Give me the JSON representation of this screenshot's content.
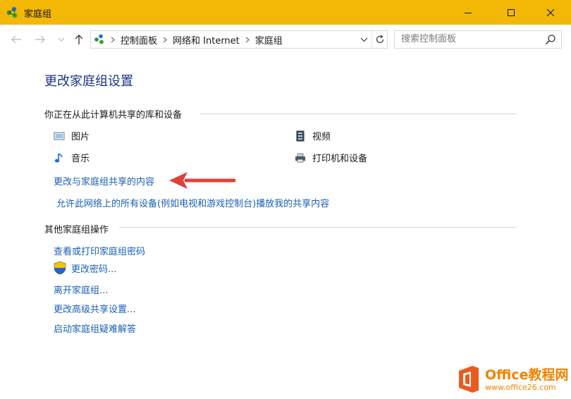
{
  "window": {
    "title": "家庭组",
    "accent_color": "#f3b806"
  },
  "address_bar": {
    "breadcrumbs": [
      "控制面板",
      "网络和 Internet",
      "家庭组"
    ],
    "search_placeholder": "搜索控制面板"
  },
  "main": {
    "title": "更改家庭组设置",
    "sharing_section": {
      "heading": "你正在从此计算机共享的库和设备",
      "items": [
        {
          "label": "图片",
          "icon": "pictures-icon"
        },
        {
          "label": "视频",
          "icon": "videos-icon"
        },
        {
          "label": "音乐",
          "icon": "music-icon"
        },
        {
          "label": "打印机和设备",
          "icon": "printer-icon"
        }
      ],
      "links": {
        "change_shared": "更改与家庭组共享的内容",
        "allow_devices": "允许此网络上的所有设备(例如电视和游戏控制台)播放我的共享内容"
      }
    },
    "other_section": {
      "heading": "其他家庭组操作",
      "links": {
        "view_password": "查看或打印家庭组密码",
        "change_password": "更改密码...",
        "leave": "离开家庭组...",
        "advanced": "更改高级共享设置...",
        "troubleshoot": "启动家庭组疑难解答"
      }
    }
  },
  "watermark": {
    "name": "Office教程网",
    "url": "www.office26.com"
  },
  "colors": {
    "link": "#1a5fb4",
    "heading": "#1e3287",
    "arrow": "#e0403a"
  }
}
